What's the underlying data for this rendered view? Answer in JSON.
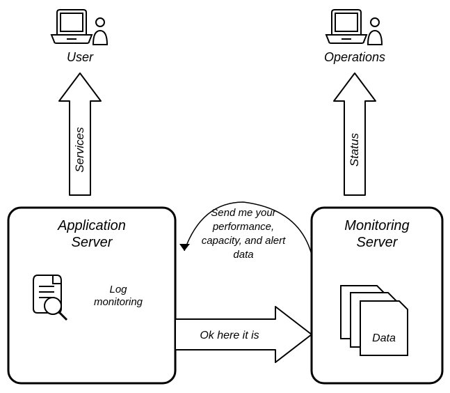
{
  "actors": {
    "user": {
      "label": "User"
    },
    "operations": {
      "label": "Operations"
    }
  },
  "arrows": {
    "services": {
      "label": "Services"
    },
    "status": {
      "label": "Status"
    }
  },
  "servers": {
    "app": {
      "title": "Application Server",
      "feature": "Log monitoring"
    },
    "monitor": {
      "title": "Monitoring Server",
      "data_label": "Data"
    }
  },
  "messages": {
    "request_line1": "Send me your",
    "request_line2": "performance,",
    "request_line3": "capacity, and alert",
    "request_line4": "data",
    "response": "Ok here it is"
  }
}
